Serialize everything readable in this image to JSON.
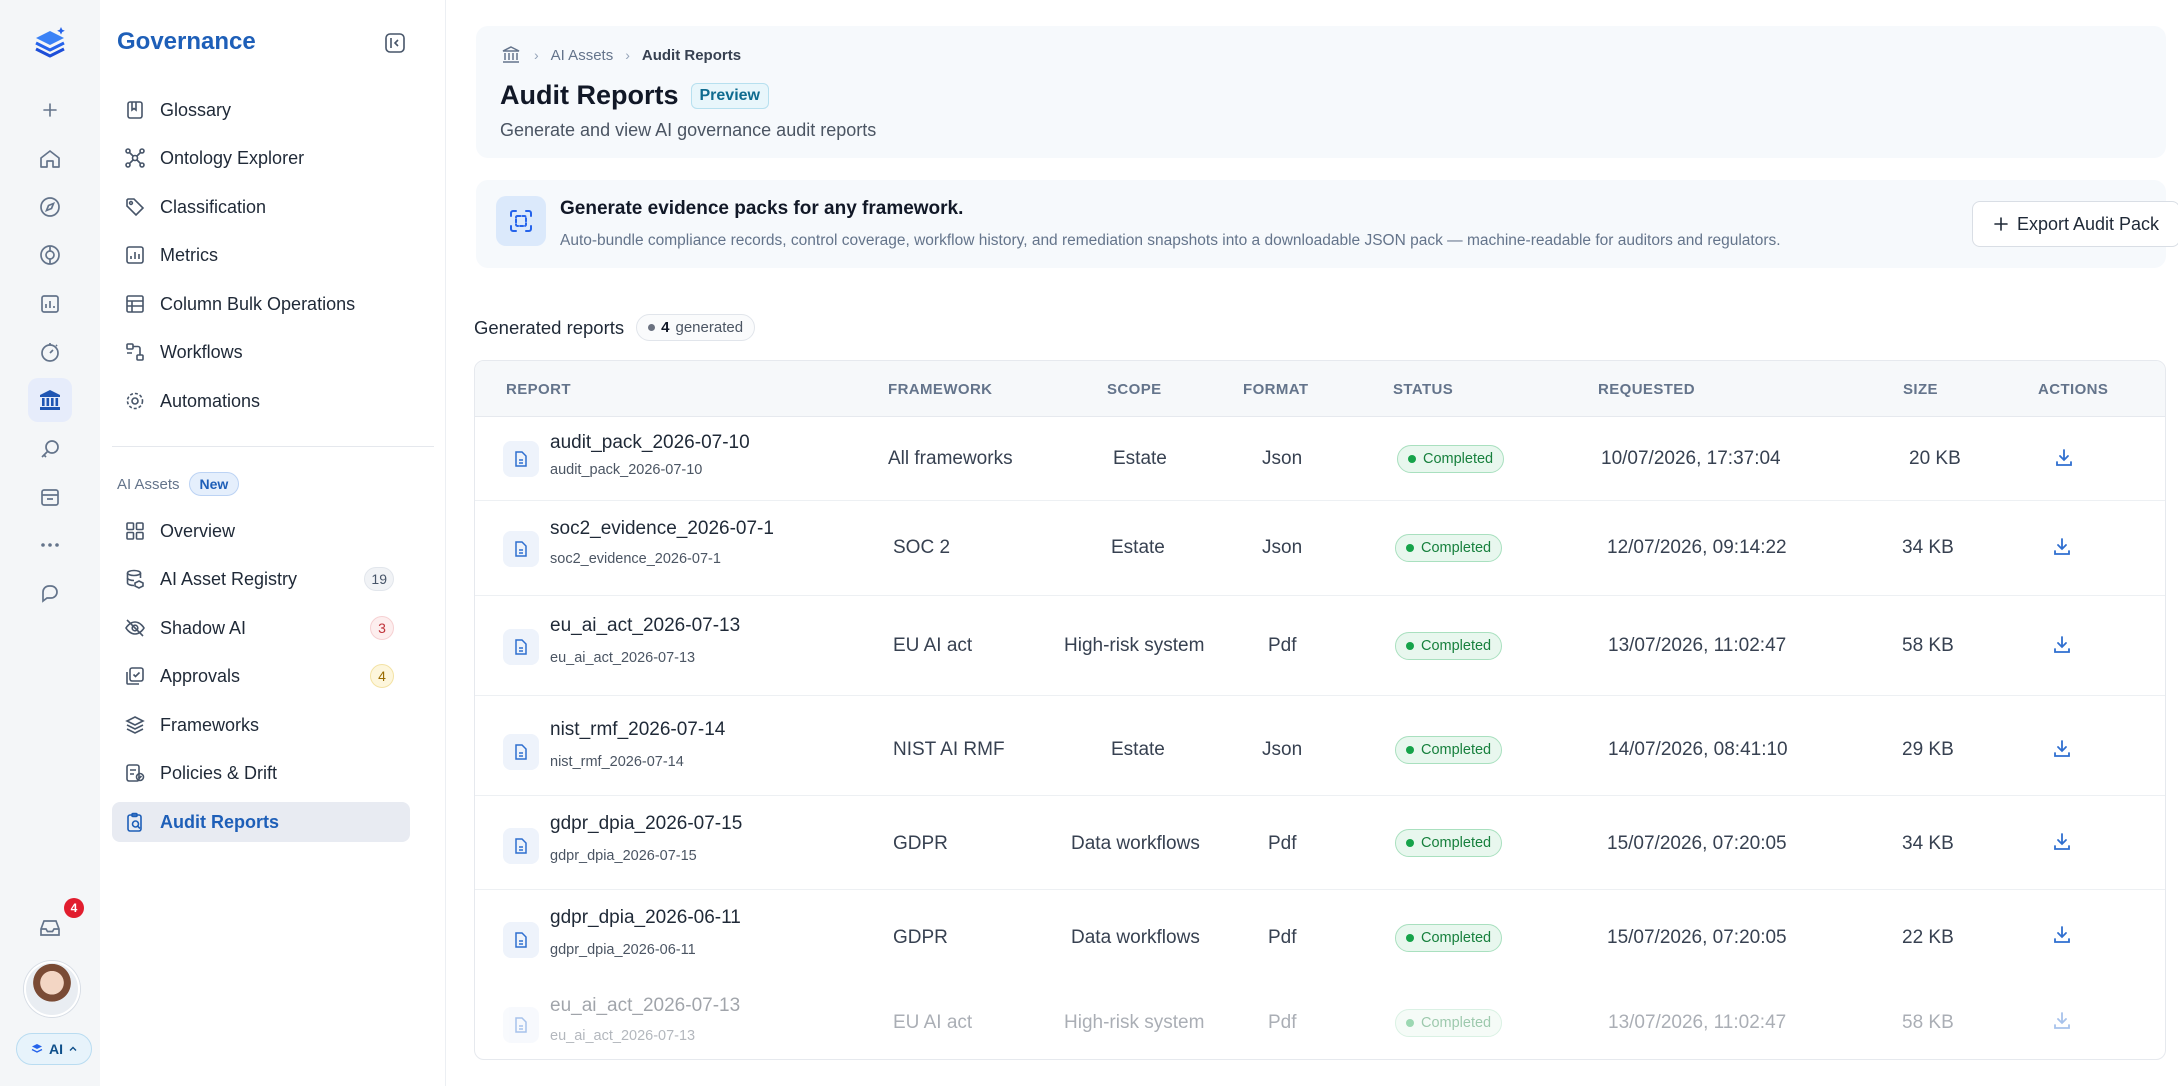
{
  "rail": {
    "notifications_count": "4",
    "ai_label": "AI"
  },
  "sidebar": {
    "title": "Governance",
    "items": [
      {
        "label": "Glossary"
      },
      {
        "label": "Ontology Explorer"
      },
      {
        "label": "Classification"
      },
      {
        "label": "Metrics"
      },
      {
        "label": "Column Bulk Operations"
      },
      {
        "label": "Workflows"
      },
      {
        "label": "Automations"
      }
    ],
    "section_label": "AI Assets",
    "section_badge": "New",
    "ai_items": [
      {
        "label": "Overview"
      },
      {
        "label": "AI Asset Registry",
        "count": "19"
      },
      {
        "label": "Shadow AI",
        "count": "3"
      },
      {
        "label": "Approvals",
        "count": "4"
      },
      {
        "label": "Frameworks"
      },
      {
        "label": "Policies & Drift"
      },
      {
        "label": "Audit Reports"
      }
    ]
  },
  "breadcrumb": {
    "parent": "AI Assets",
    "current": "Audit Reports"
  },
  "page": {
    "title": "Audit Reports",
    "badge": "Preview",
    "subtitle": "Generate and view AI governance audit reports"
  },
  "banner": {
    "title": "Generate evidence packs for any framework.",
    "description": "Auto-bundle compliance records, control coverage, workflow history, and remediation snapshots into a downloadable JSON pack — machine-readable for auditors and regulators.",
    "button_label": "Export Audit Pack"
  },
  "reports": {
    "heading": "Generated reports",
    "count": "4",
    "count_suffix": "generated",
    "columns": [
      "REPORT",
      "FRAMEWORK",
      "SCOPE",
      "FORMAT",
      "STATUS",
      "REQUESTED",
      "SIZE",
      "ACTIONS"
    ],
    "rows": [
      {
        "name": "audit_pack_2026-07-10",
        "sub": "audit_pack_2026-07-10",
        "framework": "All frameworks",
        "scope": "Estate",
        "format": "Json",
        "status": "Completed",
        "requested": "10/07/2026, 17:37:04",
        "size": "20 KB"
      },
      {
        "name": "soc2_evidence_2026-07-1",
        "sub": "soc2_evidence_2026-07-1",
        "framework": "SOC 2",
        "scope": "Estate",
        "format": "Json",
        "status": "Completed",
        "requested": "12/07/2026, 09:14:22",
        "size": "34 KB"
      },
      {
        "name": "eu_ai_act_2026-07-13",
        "sub": "eu_ai_act_2026-07-13",
        "framework": "EU AI act",
        "scope": "High-risk system",
        "format": "Pdf",
        "status": "Completed",
        "requested": "13/07/2026, 11:02:47",
        "size": "58 KB"
      },
      {
        "name": "nist_rmf_2026-07-14",
        "sub": "nist_rmf_2026-07-14",
        "framework": "NIST AI RMF",
        "scope": "Estate",
        "format": "Json",
        "status": "Completed",
        "requested": "14/07/2026, 08:41:10",
        "size": "29 KB"
      },
      {
        "name": "gdpr_dpia_2026-07-15",
        "sub": "gdpr_dpia_2026-07-15",
        "framework": "GDPR",
        "scope": "Data workflows",
        "format": "Pdf",
        "status": "Completed",
        "requested": "15/07/2026, 07:20:05",
        "size": "34 KB"
      },
      {
        "name": "gdpr_dpia_2026-06-11",
        "sub": "gdpr_dpia_2026-06-11",
        "framework": "GDPR",
        "scope": "Data workflows",
        "format": "Pdf",
        "status": "Completed",
        "requested": "15/07/2026, 07:20:05",
        "size": "22 KB"
      },
      {
        "name": "eu_ai_act_2026-07-13",
        "sub": "eu_ai_act_2026-07-13",
        "framework": "EU AI act",
        "scope": "High-risk system",
        "format": "Pdf",
        "status": "Completed",
        "requested": "13/07/2026, 11:02:47",
        "size": "58 KB"
      }
    ]
  }
}
